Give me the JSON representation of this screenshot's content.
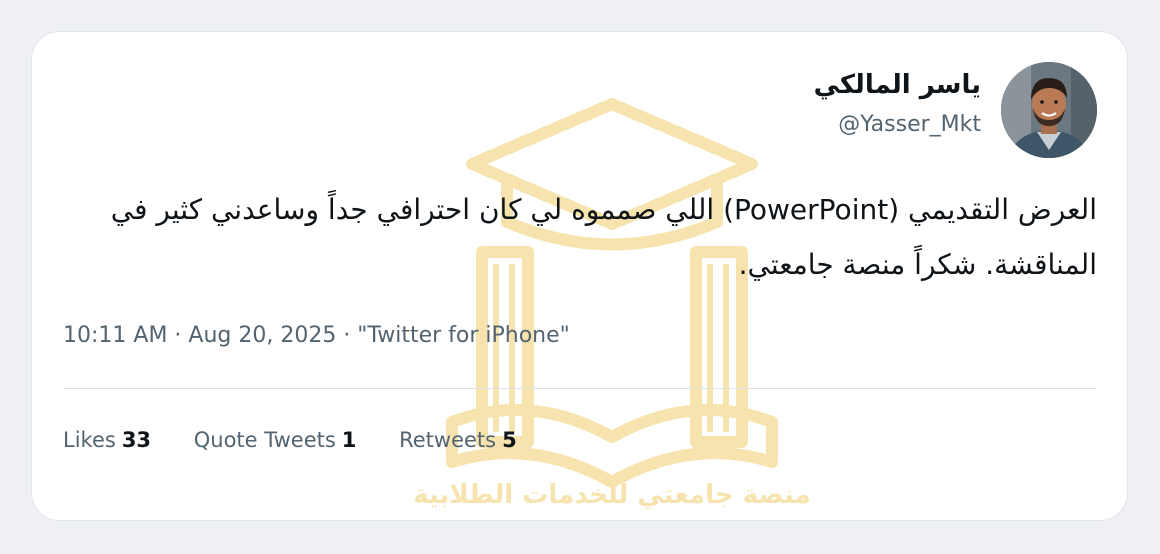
{
  "user": {
    "name": "ياسر المالكي",
    "handle": "@Yasser_Mkt"
  },
  "tweet": {
    "text": "العرض التقديمي (PowerPoint) اللي صمموه لي كان احترافي جداً وساعدني كثير في المناقشة. شكراً منصة جامعتي.",
    "meta": "10:11 AM · Aug 20, 2025 · \"Twitter for iPhone\""
  },
  "stats": {
    "likes_label": "Likes",
    "likes_count": "33",
    "quotes_label": "Quote Tweets",
    "quotes_count": "1",
    "retweets_label": "Retweets",
    "retweets_count": "5"
  },
  "watermark": {
    "text": "منصة جامعتي للخدمات الطلابية",
    "color": "#e8b62a"
  },
  "colors": {
    "background": "#eef0f4",
    "card": "#ffffff",
    "text_primary": "#0f1419",
    "text_secondary": "#536471"
  },
  "icons": {
    "avatar": "user-avatar-photo",
    "watermark": "graduation-cap-book-logo"
  }
}
